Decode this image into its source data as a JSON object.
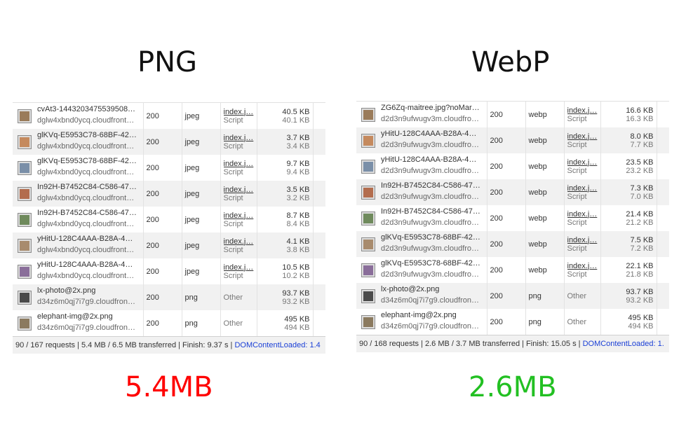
{
  "left": {
    "heading": "PNG",
    "result": "5.4MB",
    "result_color": "#ff0000",
    "rows": [
      {
        "name": "cvAt3-1443203475539508…",
        "domain": "dglw4xbnd0ycq.cloudfront…",
        "status": "200",
        "type": "jpeg",
        "initiator": "index.j…",
        "initiator_type": "Script",
        "size": "40.5 KB",
        "content": "40.1 KB",
        "icon": "image-thumbnail-icon"
      },
      {
        "name": "glKVq-E5953C78-68BF-42…",
        "domain": "dglw4xbnd0ycq.cloudfront…",
        "status": "200",
        "type": "jpeg",
        "initiator": "index.j…",
        "initiator_type": "Script",
        "size": "3.7 KB",
        "content": "3.4 KB",
        "icon": "image-thumbnail-icon"
      },
      {
        "name": "glKVq-E5953C78-68BF-42…",
        "domain": "dglw4xbnd0ycq.cloudfront…",
        "status": "200",
        "type": "jpeg",
        "initiator": "index.j…",
        "initiator_type": "Script",
        "size": "9.7 KB",
        "content": "9.4 KB",
        "icon": "image-thumbnail-icon"
      },
      {
        "name": "In92H-B7452C84-C586-47…",
        "domain": "dglw4xbnd0ycq.cloudfront…",
        "status": "200",
        "type": "jpeg",
        "initiator": "index.j…",
        "initiator_type": "Script",
        "size": "3.5 KB",
        "content": "3.2 KB",
        "icon": "image-thumbnail-icon"
      },
      {
        "name": "In92H-B7452C84-C586-47…",
        "domain": "dglw4xbnd0ycq.cloudfront…",
        "status": "200",
        "type": "jpeg",
        "initiator": "index.j…",
        "initiator_type": "Script",
        "size": "8.7 KB",
        "content": "8.4 KB",
        "icon": "image-thumbnail-icon"
      },
      {
        "name": "yHitU-128C4AAA-B28A-4…",
        "domain": "dglw4xbnd0ycq.cloudfront…",
        "status": "200",
        "type": "jpeg",
        "initiator": "index.j…",
        "initiator_type": "Script",
        "size": "4.1 KB",
        "content": "3.8 KB",
        "icon": "image-thumbnail-icon"
      },
      {
        "name": "yHitU-128C4AAA-B28A-4…",
        "domain": "dglw4xbnd0ycq.cloudfront…",
        "status": "200",
        "type": "jpeg",
        "initiator": "index.j…",
        "initiator_type": "Script",
        "size": "10.5 KB",
        "content": "10.2 KB",
        "icon": "image-thumbnail-icon"
      },
      {
        "name": "lx-photo@2x.png",
        "domain": "d34z6m0qj7i7g9.cloudfron…",
        "status": "200",
        "type": "png",
        "initiator": "Other",
        "initiator_type": "",
        "size": "93.7 KB",
        "content": "93.2 KB",
        "icon": "image-thumbnail-icon"
      },
      {
        "name": "elephant-img@2x.png",
        "domain": "d34z6m0qj7i7g9.cloudfron…",
        "status": "200",
        "type": "png",
        "initiator": "Other",
        "initiator_type": "",
        "size": "495 KB",
        "content": "494 KB",
        "icon": "image-thumbnail-icon"
      }
    ],
    "summary": "90 / 167 requests | 5.4 MB / 6.5 MB transferred | Finish: 9.37 s | ",
    "dcl": "DOMContentLoaded: 1.4"
  },
  "right": {
    "heading": "WebP",
    "result": "2.6MB",
    "result_color": "#22c022",
    "rows": [
      {
        "name": "ZG6Zq-maitree.jpg?noMar…",
        "domain": "d2d3n9ufwugv3m.cloudfro…",
        "status": "200",
        "type": "webp",
        "initiator": "index.j…",
        "initiator_type": "Script",
        "size": "16.6 KB",
        "content": "16.3 KB",
        "icon": "image-thumbnail-icon"
      },
      {
        "name": "yHitU-128C4AAA-B28A-4…",
        "domain": "d2d3n9ufwugv3m.cloudfro…",
        "status": "200",
        "type": "webp",
        "initiator": "index.j…",
        "initiator_type": "Script",
        "size": "8.0 KB",
        "content": "7.7 KB",
        "icon": "image-thumbnail-icon"
      },
      {
        "name": "yHitU-128C4AAA-B28A-4…",
        "domain": "d2d3n9ufwugv3m.cloudfro…",
        "status": "200",
        "type": "webp",
        "initiator": "index.j…",
        "initiator_type": "Script",
        "size": "23.5 KB",
        "content": "23.2 KB",
        "icon": "image-thumbnail-icon"
      },
      {
        "name": "In92H-B7452C84-C586-47…",
        "domain": "d2d3n9ufwugv3m.cloudfro…",
        "status": "200",
        "type": "webp",
        "initiator": "index.j…",
        "initiator_type": "Script",
        "size": "7.3 KB",
        "content": "7.0 KB",
        "icon": "image-thumbnail-icon"
      },
      {
        "name": "In92H-B7452C84-C586-47…",
        "domain": "d2d3n9ufwugv3m.cloudfro…",
        "status": "200",
        "type": "webp",
        "initiator": "index.j…",
        "initiator_type": "Script",
        "size": "21.4 KB",
        "content": "21.2 KB",
        "icon": "image-thumbnail-icon"
      },
      {
        "name": "glKVq-E5953C78-68BF-42…",
        "domain": "d2d3n9ufwugv3m.cloudfro…",
        "status": "200",
        "type": "webp",
        "initiator": "index.j…",
        "initiator_type": "Script",
        "size": "7.5 KB",
        "content": "7.2 KB",
        "icon": "image-thumbnail-icon"
      },
      {
        "name": "glKVq-E5953C78-68BF-42…",
        "domain": "d2d3n9ufwugv3m.cloudfro…",
        "status": "200",
        "type": "webp",
        "initiator": "index.j…",
        "initiator_type": "Script",
        "size": "22.1 KB",
        "content": "21.8 KB",
        "icon": "image-thumbnail-icon"
      },
      {
        "name": "lx-photo@2x.png",
        "domain": "d34z6m0qj7i7g9.cloudfron…",
        "status": "200",
        "type": "png",
        "initiator": "Other",
        "initiator_type": "",
        "size": "93.7 KB",
        "content": "93.2 KB",
        "icon": "image-thumbnail-icon"
      },
      {
        "name": "elephant-img@2x.png",
        "domain": "d34z6m0qj7i7g9.cloudfron…",
        "status": "200",
        "type": "png",
        "initiator": "Other",
        "initiator_type": "",
        "size": "495 KB",
        "content": "494 KB",
        "icon": "image-thumbnail-icon"
      }
    ],
    "summary": "90 / 168 requests | 2.6 MB / 3.7 MB transferred | Finish: 15.05 s | ",
    "dcl": "DOMContentLoaded: 1."
  }
}
